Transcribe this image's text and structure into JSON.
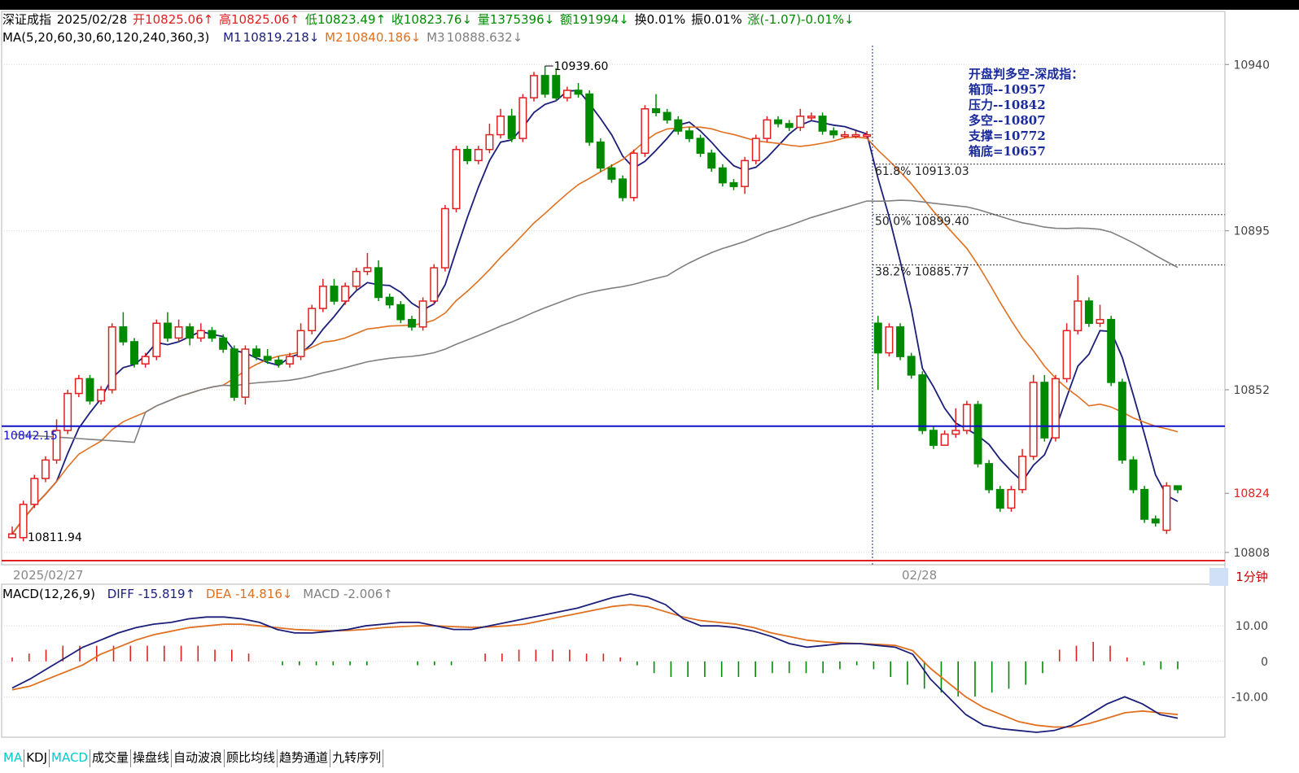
{
  "header": {
    "name": "深证成指",
    "date": "2025/02/28",
    "open_label": "开",
    "open": "10825.06↑",
    "high_label": "高",
    "high": "10825.06↑",
    "low_label": "低",
    "low": "10823.49↑",
    "close_label": "收",
    "close": "10823.76↓",
    "vol_label": "量",
    "vol": "1375396↓",
    "amt_label": "额",
    "amt": "191994↓",
    "turn_label": "换",
    "turn": "0.01%",
    "amp_label": "振",
    "amp": "0.01%",
    "chg_label": "涨",
    "chg": "(-1.07)-0.01%↓"
  },
  "ma_header": {
    "title": "MA(5,20,60,30,60,120,240,360,3)",
    "m1_label": "M1",
    "m1": "10819.218↓",
    "m2_label": "M2",
    "m2": "10840.186↓",
    "m3_label": "M3",
    "m3": "10888.632↓"
  },
  "macd_header": {
    "title": "MACD(12,26,9)",
    "diff": "DIFF -15.819↑",
    "dea": "DEA -14.816↓",
    "macd": "MACD -2.006↑"
  },
  "annotation": {
    "title": "开盘判多空-深成指：",
    "lines": [
      "箱顶--10957",
      "压力--10842",
      "多空--10807",
      "支撑=10772",
      "箱底=10657"
    ]
  },
  "period": "1分钟",
  "dates": [
    "2025/02/27",
    "02/28"
  ],
  "tabs": [
    "MA",
    "KDJ",
    "MACD",
    "成交量",
    "操盘线",
    "自动波浪",
    "顾比均线",
    "趋势通道",
    "九转序列"
  ],
  "active_tabs": [
    "MA",
    "MACD"
  ],
  "colors": {
    "up": "#e02020",
    "down": "#008a00",
    "ma1": "#1b1f7a",
    "ma2": "#e07020",
    "ma3": "#808080",
    "hline": "#1010c8",
    "bg": "#ffffff"
  },
  "chart_data": [
    {
      "type": "candlestick",
      "title": "深证成指 1分钟",
      "ylim": [
        10806,
        10946
      ],
      "y_ticks": [
        10940,
        10895,
        10852,
        10824,
        10808
      ],
      "highlight_price": 10824,
      "labels": {
        "high_mark": "10939.60",
        "low_mark": "10811.94",
        "level_line": "10842.15"
      },
      "fib_levels": [
        {
          "label": "61.8%",
          "value": 10913.03
        },
        {
          "label": "50.0%",
          "value": 10899.4
        },
        {
          "label": "38.2%",
          "value": 10885.77
        }
      ],
      "level_line": 10842.15,
      "candles": [
        [
          10812,
          10813,
          10815,
          10811.94
        ],
        [
          10812,
          10821,
          10822,
          10811
        ],
        [
          10821,
          10828,
          10829,
          10820
        ],
        [
          10828,
          10833,
          10834,
          10827
        ],
        [
          10833,
          10841,
          10844,
          10832
        ],
        [
          10841,
          10851,
          10852,
          10840
        ],
        [
          10851,
          10855,
          10856,
          10850
        ],
        [
          10855,
          10849,
          10856,
          10848
        ],
        [
          10849,
          10852,
          10853,
          10848
        ],
        [
          10852,
          10869,
          10870,
          10851
        ],
        [
          10869,
          10865,
          10873,
          10864
        ],
        [
          10865,
          10859,
          10866,
          10858
        ],
        [
          10859,
          10861,
          10862,
          10858
        ],
        [
          10861,
          10870,
          10871,
          10860
        ],
        [
          10870,
          10866,
          10873,
          10865
        ],
        [
          10866,
          10869,
          10871,
          10865
        ],
        [
          10869,
          10866,
          10870,
          10864
        ],
        [
          10866,
          10868,
          10870,
          10865
        ],
        [
          10868,
          10866,
          10869,
          10865
        ],
        [
          10866,
          10863,
          10867,
          10862
        ],
        [
          10863,
          10850,
          10864,
          10849
        ],
        [
          10850,
          10863,
          10864,
          10848
        ],
        [
          10863,
          10861,
          10864,
          10860
        ],
        [
          10861,
          10860,
          10863,
          10859
        ],
        [
          10860,
          10859,
          10861,
          10858
        ],
        [
          10859,
          10861,
          10862,
          10858
        ],
        [
          10861,
          10868,
          10870,
          10860
        ],
        [
          10868,
          10874,
          10875,
          10867
        ],
        [
          10874,
          10880,
          10882,
          10873
        ],
        [
          10880,
          10876,
          10882,
          10875
        ],
        [
          10876,
          10880,
          10881,
          10875
        ],
        [
          10880,
          10884,
          10885,
          10879
        ],
        [
          10884,
          10885,
          10889,
          10883
        ],
        [
          10885,
          10877,
          10887,
          10876
        ],
        [
          10877,
          10875,
          10878,
          10874
        ],
        [
          10875,
          10871,
          10876,
          10870
        ],
        [
          10871,
          10869,
          10872,
          10868
        ],
        [
          10869,
          10876,
          10877,
          10868
        ],
        [
          10876,
          10885,
          10886,
          10875
        ],
        [
          10885,
          10901,
          10902,
          10884
        ],
        [
          10901,
          10917,
          10918,
          10900
        ],
        [
          10917,
          10914,
          10918,
          10913
        ],
        [
          10914,
          10917,
          10918,
          10913
        ],
        [
          10917,
          10921,
          10924,
          10916
        ],
        [
          10921,
          10926,
          10928,
          10920
        ],
        [
          10926,
          10920,
          10928,
          10919
        ],
        [
          10920,
          10931,
          10932,
          10919
        ],
        [
          10931,
          10937,
          10938,
          10930
        ],
        [
          10937,
          10932,
          10939.6,
          10931
        ],
        [
          10937,
          10931,
          10939,
          10930
        ],
        [
          10931,
          10933,
          10934,
          10930
        ],
        [
          10933,
          10932,
          10935,
          10931
        ],
        [
          10932,
          10919,
          10933,
          10918
        ],
        [
          10919,
          10912,
          10920,
          10911
        ],
        [
          10912,
          10909,
          10913,
          10908
        ],
        [
          10909,
          10904,
          10910,
          10903
        ],
        [
          10904,
          10916,
          10917,
          10903
        ],
        [
          10916,
          10928,
          10929,
          10915
        ],
        [
          10928,
          10927,
          10932,
          10926
        ],
        [
          10927,
          10925,
          10928,
          10924
        ],
        [
          10925,
          10922,
          10926,
          10921
        ],
        [
          10922,
          10920,
          10923,
          10919
        ],
        [
          10920,
          10916,
          10921,
          10915
        ],
        [
          10916,
          10912,
          10917,
          10911
        ],
        [
          10912,
          10908,
          10913,
          10907
        ],
        [
          10908,
          10907,
          10909,
          10906
        ],
        [
          10907,
          10914,
          10915,
          10905
        ],
        [
          10914,
          10920,
          10921,
          10913
        ],
        [
          10920,
          10925,
          10926,
          10919
        ],
        [
          10925,
          10924,
          10926,
          10923
        ],
        [
          10924,
          10923,
          10925,
          10922
        ],
        [
          10923,
          10926,
          10928,
          10922
        ],
        [
          10926,
          10926,
          10927,
          10925
        ],
        [
          10926,
          10922,
          10927,
          10921
        ],
        [
          10922,
          10921,
          10923,
          10920
        ],
        [
          10921,
          10921,
          10922,
          10920
        ],
        [
          10921,
          10921,
          10922,
          10920
        ],
        [
          10921,
          10921,
          10922,
          10920
        ],
        [
          10870,
          10862,
          10872,
          10852
        ],
        [
          10862,
          10869,
          10870,
          10861
        ],
        [
          10869,
          10861,
          10870,
          10860
        ],
        [
          10861,
          10856,
          10862,
          10855
        ],
        [
          10856,
          10841,
          10857,
          10840
        ],
        [
          10841,
          10837,
          10842,
          10836
        ],
        [
          10837,
          10840,
          10841,
          10837
        ],
        [
          10840,
          10841,
          10847,
          10839
        ],
        [
          10841,
          10848,
          10849,
          10840
        ],
        [
          10848,
          10832,
          10849,
          10831
        ],
        [
          10832,
          10825,
          10833,
          10824
        ],
        [
          10825,
          10820,
          10826,
          10819
        ],
        [
          10820,
          10825,
          10826,
          10819
        ],
        [
          10825,
          10834,
          10836,
          10824
        ],
        [
          10834,
          10854,
          10856,
          10833
        ],
        [
          10854,
          10839,
          10856,
          10838
        ],
        [
          10839,
          10855,
          10856,
          10838
        ],
        [
          10855,
          10868,
          10870,
          10854
        ],
        [
          10868,
          10876,
          10883,
          10867
        ],
        [
          10876,
          10870,
          10877,
          10869
        ],
        [
          10870,
          10871,
          10875,
          10869
        ],
        [
          10871,
          10854,
          10872,
          10853
        ],
        [
          10854,
          10833,
          10855,
          10832
        ],
        [
          10833,
          10825,
          10834,
          10824
        ],
        [
          10825,
          10817,
          10826,
          10816
        ],
        [
          10817,
          10816,
          10818,
          10815
        ],
        [
          10814,
          10826,
          10827,
          10813
        ],
        [
          10826,
          10825,
          10826,
          10824
        ]
      ],
      "ma_lines_shown": [
        "M1",
        "M2",
        "M3"
      ]
    },
    {
      "type": "macd",
      "title": "MACD(12,26,9)",
      "ylim": [
        -20,
        19
      ],
      "y_ticks": [
        10.0,
        0,
        -10.0
      ],
      "series": [
        {
          "name": "DIFF",
          "values": [
            -7.5,
            -5,
            -2,
            1,
            4,
            6,
            8,
            9.5,
            10.5,
            11,
            12,
            12.5,
            12.5,
            12,
            11,
            9,
            8,
            8,
            8.5,
            9,
            10,
            10.5,
            11,
            11,
            10,
            9,
            9,
            10,
            11,
            12,
            13,
            14,
            15,
            16.5,
            18,
            19,
            18,
            16,
            12,
            10,
            10,
            9.5,
            8.5,
            7,
            5,
            4,
            4.5,
            5,
            5,
            4.5,
            4,
            2,
            -5,
            -10,
            -15,
            -18,
            -19,
            -19.5,
            -20,
            -19.5,
            -18,
            -15,
            -12,
            -10,
            -12,
            -15,
            -16
          ]
        },
        {
          "name": "DEA",
          "values": [
            -8,
            -7,
            -5,
            -3,
            -1,
            2,
            4,
            6,
            7.5,
            8.5,
            9.5,
            10,
            10.5,
            10.5,
            10,
            9.5,
            9,
            8.8,
            8.6,
            8.7,
            9,
            9.5,
            9.8,
            10,
            10,
            9.8,
            9.6,
            9.7,
            10,
            10.5,
            11.5,
            12.5,
            13.5,
            14.5,
            15.5,
            16,
            15.5,
            14,
            12.5,
            11.5,
            11,
            10.5,
            9.5,
            8,
            7,
            6,
            5.5,
            5.2,
            5,
            4.8,
            4.5,
            3,
            -2,
            -6,
            -10,
            -13,
            -15,
            -17,
            -18,
            -18.5,
            -18.5,
            -17.5,
            -16,
            -14.5,
            -14,
            -14.5,
            -15
          ]
        },
        {
          "name": "MACD",
          "values": [
            1,
            2,
            3,
            4,
            4,
            4,
            4,
            4,
            4,
            4,
            4,
            4,
            3,
            3,
            2,
            0,
            -1,
            -1,
            -1,
            -1,
            -1,
            -1,
            0,
            0,
            -1,
            -1,
            -1,
            0,
            2,
            2,
            3,
            3,
            3,
            3,
            2,
            2,
            1,
            -1,
            -3,
            -4,
            -4,
            -4,
            -4,
            -4,
            -4,
            -3,
            -3,
            -3,
            -3,
            -2,
            -1,
            -2,
            -4,
            -6,
            -7,
            -8,
            -9,
            -9,
            -8,
            -7,
            -6,
            -3,
            3,
            4,
            5,
            4,
            1,
            -1,
            -2,
            -2
          ]
        }
      ]
    }
  ]
}
